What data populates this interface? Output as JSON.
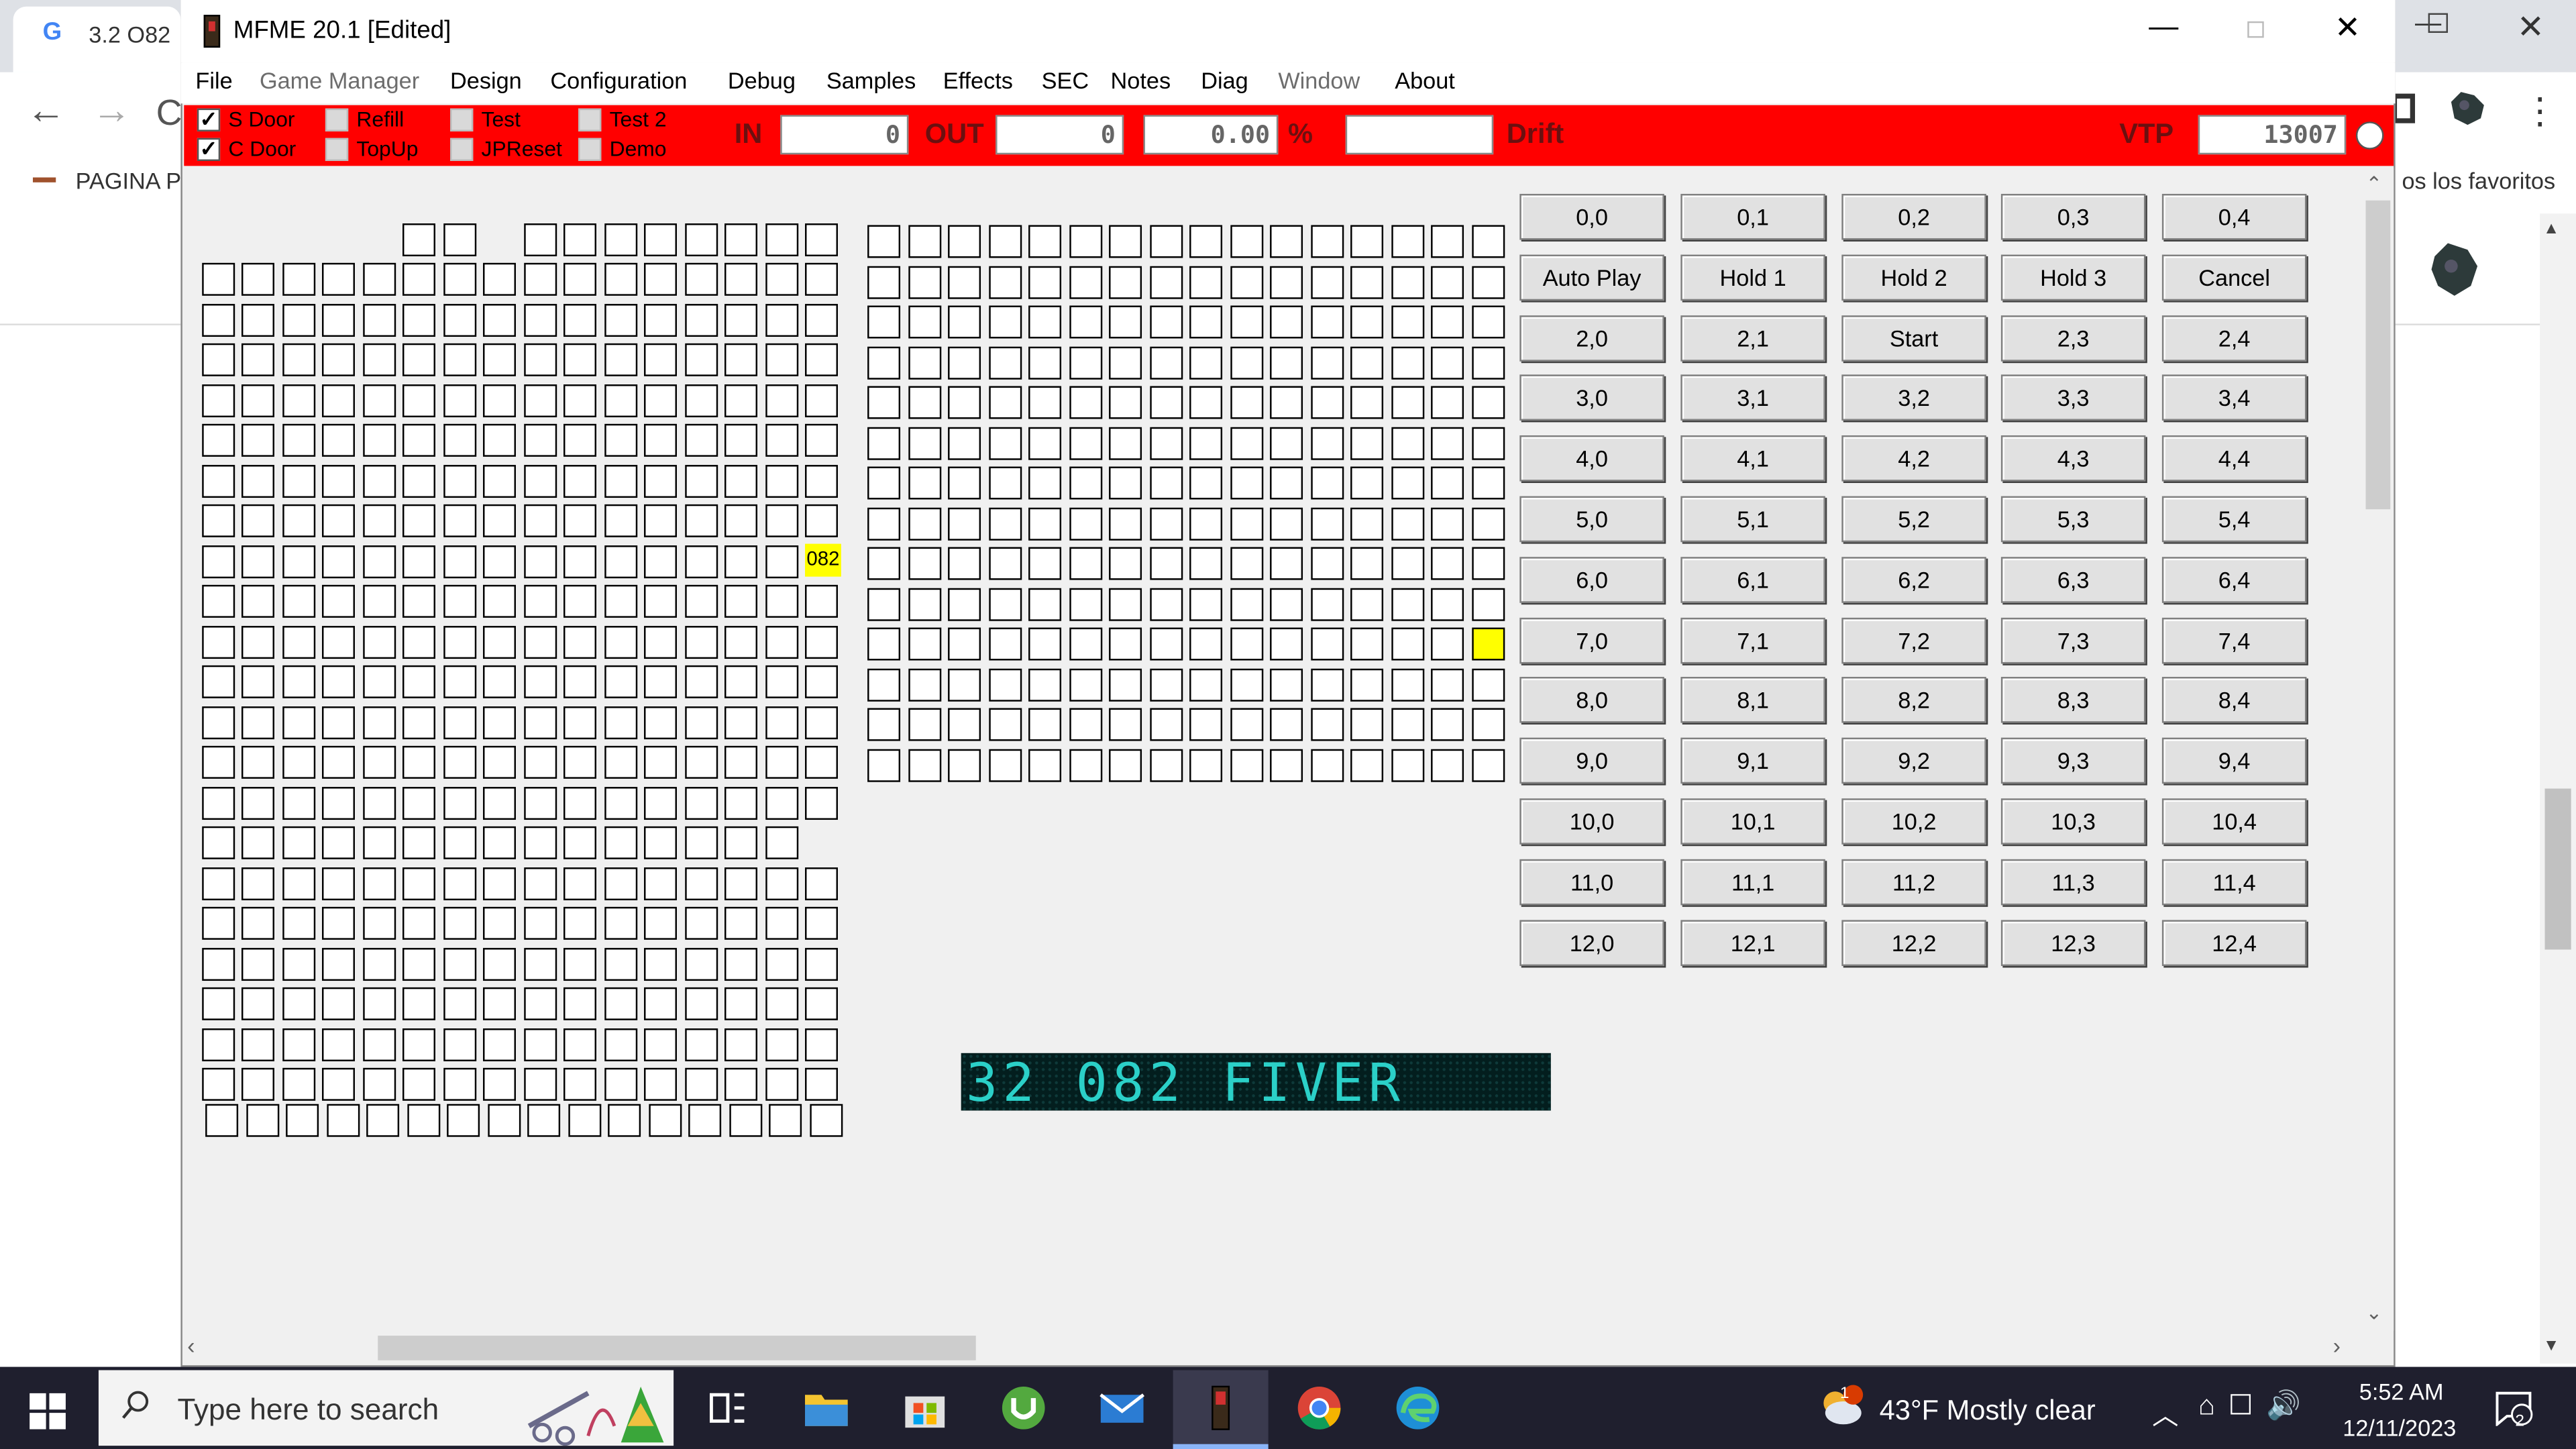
{
  "browser": {
    "tab_title": "3.2 O82",
    "bookmark_label": "PAGINA P",
    "bookmarks_right": "os los favoritos"
  },
  "window": {
    "title": "MFME 20.1 [Edited]"
  },
  "menu": [
    "File",
    "Game Manager",
    "Design",
    "Configuration",
    "Debug",
    "Samples",
    "Effects",
    "SEC",
    "Notes",
    "Diag",
    "Window",
    "About"
  ],
  "menu_disabled": [
    "Game Manager",
    "Window"
  ],
  "toolbar": {
    "checkboxes": [
      {
        "label": "S Door",
        "checked": true
      },
      {
        "label": "C Door",
        "checked": true
      },
      {
        "label": "Refill",
        "checked": false
      },
      {
        "label": "TopUp",
        "checked": false
      },
      {
        "label": "Test",
        "checked": false
      },
      {
        "label": "JPReset",
        "checked": false
      },
      {
        "label": "Test 2",
        "checked": false
      },
      {
        "label": "Demo",
        "checked": false
      }
    ],
    "in_label": "IN",
    "in_value": "0",
    "out_label": "OUT",
    "out_value": "0",
    "percent_value": "0.00",
    "percent_label": "%",
    "drift_value": "",
    "drift_label": "Drift",
    "vtp_label": "VTP",
    "vtp_value": "13007",
    "accent_color": "#ff0000"
  },
  "lamps": {
    "left_label": "082",
    "highlight_color": "#ffff00"
  },
  "buttons": [
    [
      "0,0",
      "0,1",
      "0,2",
      "0,3",
      "0,4"
    ],
    [
      "Auto Play",
      "Hold 1",
      "Hold 2",
      "Hold 3",
      "Cancel"
    ],
    [
      "2,0",
      "2,1",
      "Start",
      "2,3",
      "2,4"
    ],
    [
      "3,0",
      "3,1",
      "3,2",
      "3,3",
      "3,4"
    ],
    [
      "4,0",
      "4,1",
      "4,2",
      "4,3",
      "4,4"
    ],
    [
      "5,0",
      "5,1",
      "5,2",
      "5,3",
      "5,4"
    ],
    [
      "6,0",
      "6,1",
      "6,2",
      "6,3",
      "6,4"
    ],
    [
      "7,0",
      "7,1",
      "7,2",
      "7,3",
      "7,4"
    ],
    [
      "8,0",
      "8,1",
      "8,2",
      "8,3",
      "8,4"
    ],
    [
      "9,0",
      "9,1",
      "9,2",
      "9,3",
      "9,4"
    ],
    [
      "10,0",
      "10,1",
      "10,2",
      "10,3",
      "10,4"
    ],
    [
      "11,0",
      "11,1",
      "11,2",
      "11,3",
      "11,4"
    ],
    [
      "12,0",
      "12,1",
      "12,2",
      "12,3",
      "12,4"
    ]
  ],
  "display": {
    "text": "32 082 FIVER",
    "color": "#2bd0c8"
  },
  "taskbar": {
    "search_placeholder": "Type here to search",
    "weather": "43°F  Mostly clear",
    "weather_badge": "1",
    "time": "5:52 AM",
    "date": "12/11/2023",
    "notification_count": "2"
  }
}
